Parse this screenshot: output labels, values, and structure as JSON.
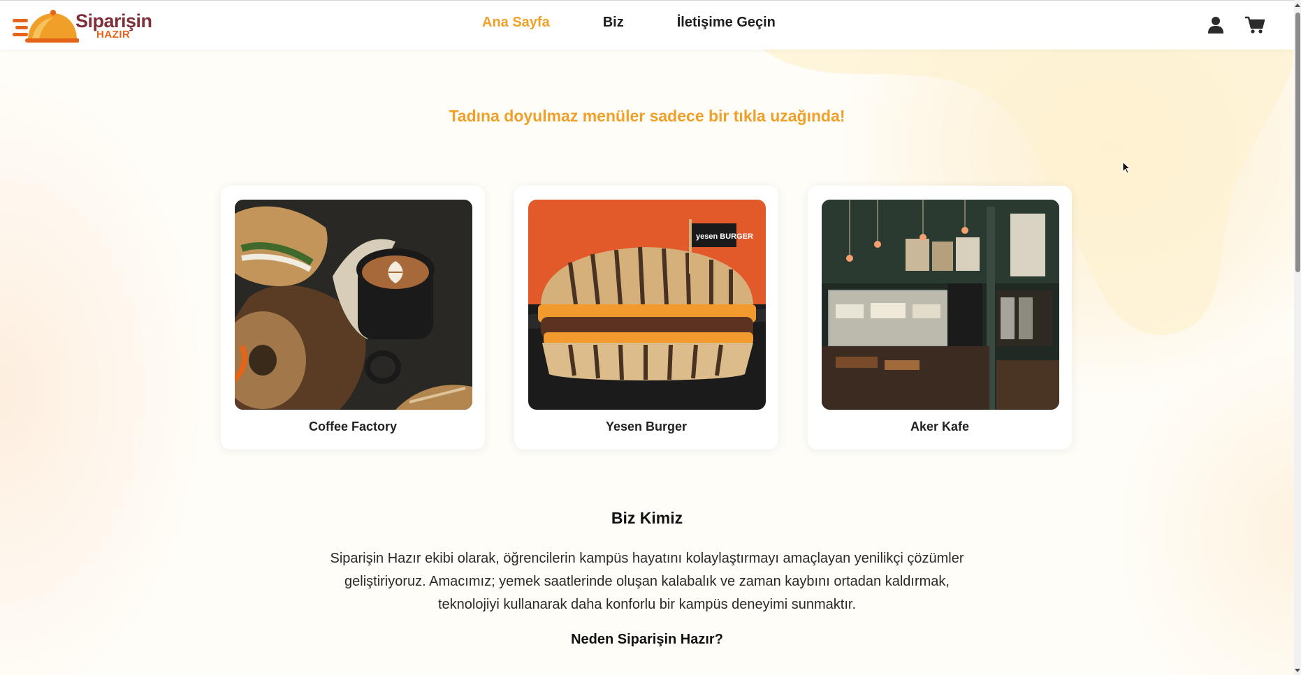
{
  "header": {
    "logo": {
      "title": "Siparişin",
      "subtitle": "HAZIR"
    },
    "nav": [
      {
        "label": "Ana Sayfa",
        "active": true
      },
      {
        "label": "Biz",
        "active": false
      },
      {
        "label": "İletişime Geçin",
        "active": false
      }
    ],
    "icons": [
      "user-icon",
      "cart-icon"
    ]
  },
  "main": {
    "tagline": "Tadına doyulmaz menüler sadece bir tıkla uzağında!",
    "restaurants": [
      {
        "name": "Coffee Factory"
      },
      {
        "name": "Yesen Burger",
        "flag_text": "yesen BURGER"
      },
      {
        "name": "Aker Kafe"
      }
    ],
    "about": {
      "title": "Biz Kimiz",
      "text": "Siparişin Hazır ekibi olarak, öğrencilerin kampüs hayatını kolaylaştırmayı amaçlayan yenilikçi çözümler geliştiriyoruz. Amacımız; yemek saatlerinde oluşan kalabalık ve zaman kaybını ortadan kaldırmak, teknolojiyi kullanarak daha konforlu bir kampüs deneyimi sunmaktır.",
      "why_title": "Neden Siparişin Hazır?"
    }
  },
  "colors": {
    "accent": "#f0a028",
    "logo_dark": "#7e2f3a",
    "logo_orange": "#e5641a",
    "burger_bg": "#e35a2a"
  }
}
